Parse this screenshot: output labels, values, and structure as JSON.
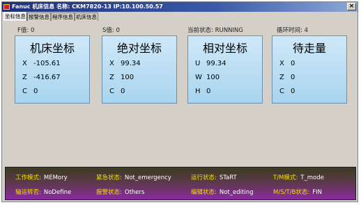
{
  "window": {
    "title": "Fanuc 机床信息  名称: CKM7820-13  IP:10.100.50.57",
    "close_label": "×"
  },
  "tabs": [
    {
      "label": "坐标信息",
      "active": true
    },
    {
      "label": "报警信息",
      "active": false
    },
    {
      "label": "程序信息",
      "active": false
    },
    {
      "label": "机床信息",
      "active": false
    }
  ],
  "stats": {
    "f_value": "F值:  0",
    "s_value": "S值:  0",
    "current_state": "当前状态:  RUNNING",
    "loop_time": "循环时间:  4"
  },
  "panels": [
    {
      "title": "机床坐标",
      "rows": [
        {
          "axis": "X",
          "value": "-105.61"
        },
        {
          "axis": "Z",
          "value": "-416.67"
        },
        {
          "axis": "C",
          "value": "0"
        }
      ]
    },
    {
      "title": "绝对坐标",
      "rows": [
        {
          "axis": "X",
          "value": "99.34"
        },
        {
          "axis": "Z",
          "value": "100"
        },
        {
          "axis": "C",
          "value": "0"
        }
      ]
    },
    {
      "title": "相对坐标",
      "rows": [
        {
          "axis": "U",
          "value": "99.34"
        },
        {
          "axis": "W",
          "value": "100"
        },
        {
          "axis": "H",
          "value": "0"
        }
      ]
    },
    {
      "title": "待走量",
      "rows": [
        {
          "axis": "X",
          "value": "0"
        },
        {
          "axis": "Z",
          "value": "0"
        },
        {
          "axis": "C",
          "value": "0"
        }
      ]
    }
  ],
  "status_bar": {
    "work_mode": {
      "label": "工作模式:",
      "value": "MEMory"
    },
    "emergency": {
      "label": "紧急状态:",
      "value": "Not_emergency"
    },
    "run_state": {
      "label": "运行状态:",
      "value": "STaRT"
    },
    "tm_mode": {
      "label": "T/M模式:",
      "value": "T_mode"
    },
    "spindle_dir": {
      "label": "轴运转否:",
      "value": "NoDefine"
    },
    "alarm_state": {
      "label": "报警状态:",
      "value": "Others"
    },
    "edit_state": {
      "label": "编辑状态:",
      "value": "Not_editing"
    },
    "msbt_state": {
      "label": "M/S/T/B状态:",
      "value": "FIN"
    }
  },
  "colors": {
    "panel_fill": "#a9d5ef",
    "status_label": "#f0e000",
    "status_value": "#ffffff",
    "titlebar": "#1f2f7a"
  }
}
